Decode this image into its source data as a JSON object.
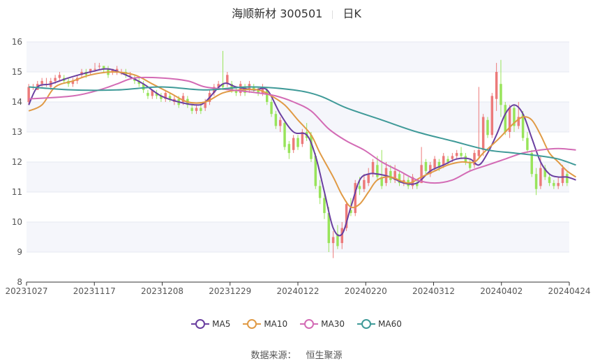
{
  "title": {
    "name": "海顺新材 300501",
    "period": "日K"
  },
  "source": {
    "label": "数据来源：",
    "value": "恒生聚源"
  },
  "colors": {
    "up": "#ec7a7a",
    "down": "#98e45a",
    "ma5": "#6a3fa0",
    "ma10": "#e09a45",
    "ma30": "#d36bb5",
    "ma60": "#3f9a98",
    "grid": "#e5e8f0",
    "band": "#f5f6fb"
  },
  "chart_data": {
    "type": "candlestick",
    "ylim": [
      8,
      16
    ],
    "yticks": [
      8,
      9,
      10,
      11,
      12,
      13,
      14,
      15,
      16
    ],
    "xticks": [
      "20231027",
      "20231117",
      "20231208",
      "20231229",
      "20240122",
      "20240220",
      "20240312",
      "20240402",
      "20240424"
    ],
    "candles": [
      [
        14.0,
        14.5,
        14.6,
        13.9
      ],
      [
        14.5,
        14.5,
        14.6,
        14.4
      ],
      [
        14.4,
        14.6,
        14.7,
        14.4
      ],
      [
        14.6,
        14.7,
        14.8,
        14.5
      ],
      [
        14.6,
        14.6,
        14.8,
        14.5
      ],
      [
        14.5,
        14.7,
        14.8,
        14.4
      ],
      [
        14.7,
        14.8,
        14.9,
        14.6
      ],
      [
        14.8,
        14.9,
        15.0,
        14.7
      ],
      [
        14.8,
        14.7,
        14.9,
        14.6
      ],
      [
        14.7,
        14.6,
        14.8,
        14.5
      ],
      [
        14.6,
        14.7,
        14.8,
        14.5
      ],
      [
        14.7,
        14.8,
        14.9,
        14.6
      ],
      [
        14.9,
        15.0,
        15.1,
        14.8
      ],
      [
        15.0,
        14.9,
        15.1,
        14.8
      ],
      [
        15.0,
        15.1,
        15.1,
        14.9
      ],
      [
        15.1,
        15.1,
        15.3,
        15.0
      ],
      [
        15.2,
        15.2,
        15.3,
        15.1
      ],
      [
        15.2,
        15.1,
        15.2,
        15.0
      ],
      [
        15.1,
        14.9,
        15.2,
        14.8
      ],
      [
        15.0,
        15.1,
        15.1,
        14.9
      ],
      [
        15.0,
        15.1,
        15.2,
        14.9
      ],
      [
        15.0,
        15.0,
        15.1,
        14.9
      ],
      [
        15.0,
        14.9,
        15.1,
        14.8
      ],
      [
        14.9,
        14.9,
        15.0,
        14.8
      ],
      [
        14.8,
        14.7,
        14.9,
        14.6
      ],
      [
        14.7,
        14.6,
        14.8,
        14.5
      ],
      [
        14.6,
        14.4,
        14.7,
        14.3
      ],
      [
        14.3,
        14.2,
        14.4,
        14.1
      ],
      [
        14.2,
        14.4,
        14.4,
        14.1
      ],
      [
        14.3,
        14.2,
        14.4,
        14.1
      ],
      [
        14.2,
        14.1,
        14.3,
        14.0
      ],
      [
        14.1,
        14.3,
        14.4,
        14.0
      ],
      [
        14.2,
        14.1,
        14.3,
        14.0
      ],
      [
        14.0,
        14.1,
        14.2,
        13.9
      ],
      [
        14.1,
        13.9,
        14.2,
        13.8
      ],
      [
        14.0,
        14.2,
        14.3,
        13.9
      ],
      [
        14.1,
        13.9,
        14.2,
        13.8
      ],
      [
        13.8,
        13.7,
        13.9,
        13.6
      ],
      [
        13.7,
        13.8,
        13.9,
        13.6
      ],
      [
        13.8,
        13.7,
        14.0,
        13.6
      ],
      [
        13.8,
        14.0,
        14.1,
        13.7
      ],
      [
        14.0,
        14.3,
        14.4,
        13.9
      ],
      [
        14.3,
        14.5,
        14.6,
        14.2
      ],
      [
        14.5,
        14.6,
        14.7,
        14.4
      ],
      [
        14.6,
        14.5,
        15.7,
        14.4
      ],
      [
        14.6,
        14.9,
        15.0,
        14.5
      ],
      [
        14.6,
        14.4,
        14.7,
        14.3
      ],
      [
        14.4,
        14.3,
        14.5,
        14.2
      ],
      [
        14.3,
        14.6,
        14.7,
        14.2
      ],
      [
        14.5,
        14.3,
        14.6,
        14.2
      ],
      [
        14.4,
        14.6,
        14.7,
        14.3
      ],
      [
        14.5,
        14.4,
        14.6,
        14.3
      ],
      [
        14.4,
        14.3,
        14.5,
        14.2
      ],
      [
        14.3,
        14.5,
        14.6,
        14.2
      ],
      [
        14.4,
        14.0,
        14.5,
        13.9
      ],
      [
        14.0,
        13.6,
        14.1,
        13.5
      ],
      [
        13.6,
        13.2,
        13.7,
        13.1
      ],
      [
        13.2,
        13.4,
        13.5,
        13.0
      ],
      [
        13.3,
        12.5,
        13.4,
        12.4
      ],
      [
        12.6,
        12.3,
        12.7,
        12.1
      ],
      [
        12.4,
        12.8,
        12.9,
        12.3
      ],
      [
        12.8,
        12.5,
        12.9,
        12.4
      ],
      [
        12.6,
        13.0,
        13.1,
        12.5
      ],
      [
        13.0,
        12.8,
        13.3,
        12.7
      ],
      [
        12.9,
        12.1,
        13.0,
        12.0
      ],
      [
        12.2,
        11.2,
        12.3,
        11.1
      ],
      [
        11.2,
        10.8,
        11.4,
        10.6
      ],
      [
        10.8,
        10.3,
        11.0,
        10.1
      ],
      [
        10.3,
        9.3,
        10.5,
        9.0
      ],
      [
        9.3,
        9.5,
        9.7,
        8.8
      ],
      [
        9.6,
        9.2,
        9.9,
        9.1
      ],
      [
        9.3,
        9.8,
        10.0,
        9.1
      ],
      [
        9.8,
        10.6,
        10.7,
        9.7
      ],
      [
        10.4,
        10.3,
        10.8,
        10.2
      ],
      [
        10.3,
        11.3,
        11.4,
        10.2
      ],
      [
        11.2,
        11.1,
        11.5,
        10.9
      ],
      [
        11.1,
        11.4,
        11.6,
        11.0
      ],
      [
        11.3,
        11.6,
        11.8,
        11.2
      ],
      [
        11.6,
        12.0,
        12.1,
        11.5
      ],
      [
        11.9,
        11.5,
        12.2,
        11.4
      ],
      [
        11.5,
        11.2,
        12.4,
        11.1
      ],
      [
        11.3,
        11.8,
        12.0,
        11.2
      ],
      [
        11.7,
        11.4,
        11.9,
        11.3
      ],
      [
        11.4,
        11.7,
        11.9,
        11.3
      ],
      [
        11.6,
        11.3,
        11.7,
        11.2
      ],
      [
        11.3,
        11.4,
        11.6,
        11.2
      ],
      [
        11.4,
        11.2,
        11.5,
        11.1
      ],
      [
        11.2,
        11.5,
        11.6,
        11.1
      ],
      [
        11.3,
        11.2,
        11.4,
        11.1
      ],
      [
        11.3,
        11.9,
        12.5,
        11.3
      ],
      [
        12.0,
        11.7,
        12.1,
        11.6
      ],
      [
        11.6,
        11.9,
        12.0,
        11.5
      ],
      [
        11.8,
        12.1,
        12.2,
        11.7
      ],
      [
        12.0,
        11.8,
        12.1,
        11.7
      ],
      [
        11.9,
        12.2,
        12.3,
        11.8
      ],
      [
        12.1,
        12.0,
        12.2,
        11.9
      ],
      [
        12.1,
        12.2,
        12.3,
        12.0
      ],
      [
        12.2,
        12.3,
        12.4,
        12.1
      ],
      [
        12.3,
        12.2,
        12.5,
        12.1
      ],
      [
        12.2,
        12.0,
        12.3,
        11.9
      ],
      [
        12.0,
        11.8,
        12.1,
        11.7
      ],
      [
        11.9,
        12.3,
        12.4,
        11.8
      ],
      [
        12.2,
        12.4,
        14.5,
        12.1
      ],
      [
        12.4,
        13.5,
        13.6,
        12.2
      ],
      [
        13.4,
        12.9,
        13.5,
        12.8
      ],
      [
        12.9,
        14.2,
        14.3,
        12.8
      ],
      [
        14.1,
        15.0,
        15.3,
        13.7
      ],
      [
        14.6,
        13.9,
        15.4,
        13.5
      ],
      [
        13.9,
        13.0,
        14.0,
        12.9
      ],
      [
        13.0,
        13.8,
        13.9,
        12.8
      ],
      [
        13.8,
        13.2,
        13.9,
        13.0
      ],
      [
        13.2,
        13.5,
        14.0,
        13.1
      ],
      [
        13.6,
        12.8,
        13.7,
        12.7
      ],
      [
        12.8,
        12.4,
        13.0,
        12.3
      ],
      [
        12.3,
        11.6,
        12.4,
        11.5
      ],
      [
        11.6,
        11.1,
        11.8,
        10.9
      ],
      [
        11.2,
        11.8,
        12.2,
        11.1
      ],
      [
        11.8,
        11.5,
        11.9,
        11.4
      ],
      [
        11.5,
        11.3,
        11.6,
        11.2
      ],
      [
        11.3,
        11.2,
        11.4,
        11.1
      ],
      [
        11.2,
        11.3,
        11.5,
        11.1
      ],
      [
        11.3,
        11.8,
        11.9,
        11.2
      ],
      [
        11.6,
        11.3,
        11.7,
        11.2
      ]
    ],
    "series": [
      {
        "name": "MA5",
        "x": [
          0,
          2,
          5,
          9,
          14,
          18,
          22,
          26,
          30,
          34,
          38,
          40,
          44,
          47,
          51,
          54,
          57,
          60,
          63,
          65,
          67,
          69,
          71,
          73,
          75,
          77,
          79,
          82,
          85,
          88,
          91,
          94,
          97,
          100,
          102,
          104,
          106,
          108,
          110,
          112,
          114,
          116,
          118,
          120,
          122,
          124
        ],
        "values": [
          13.9,
          14.5,
          14.6,
          14.8,
          15.0,
          15.1,
          14.9,
          14.6,
          14.2,
          14.0,
          13.9,
          14.0,
          14.6,
          14.5,
          14.4,
          14.4,
          13.6,
          13.0,
          12.9,
          12.2,
          11.0,
          9.8,
          9.6,
          10.5,
          11.4,
          11.6,
          11.6,
          11.5,
          11.3,
          11.3,
          11.7,
          11.9,
          12.1,
          12.1,
          11.9,
          12.3,
          12.9,
          13.6,
          13.9,
          13.6,
          12.8,
          12.0,
          11.6,
          11.5,
          11.5,
          11.4
        ]
      },
      {
        "name": "MA10",
        "x": [
          0,
          3,
          6,
          10,
          14,
          19,
          24,
          28,
          32,
          36,
          40,
          44,
          48,
          52,
          55,
          58,
          61,
          64,
          66,
          69,
          71,
          73,
          75,
          77,
          79,
          82,
          86,
          89,
          92,
          95,
          98,
          101,
          103,
          106,
          108,
          110,
          112,
          114,
          116,
          118,
          120,
          122,
          124
        ],
        "values": [
          13.7,
          13.9,
          14.5,
          14.7,
          14.9,
          15.0,
          14.9,
          14.6,
          14.3,
          14.0,
          14.0,
          14.3,
          14.4,
          14.4,
          14.2,
          13.9,
          13.4,
          12.9,
          12.3,
          11.5,
          10.9,
          10.5,
          10.6,
          11.0,
          11.4,
          11.5,
          11.3,
          11.5,
          11.7,
          11.9,
          12.0,
          12.0,
          12.3,
          12.7,
          13.0,
          13.3,
          13.5,
          13.4,
          12.9,
          12.3,
          12.0,
          11.7,
          11.5
        ]
      },
      {
        "name": "MA30",
        "x": [
          0,
          10,
          16,
          20,
          24,
          30,
          36,
          40,
          46,
          52,
          56,
          60,
          64,
          68,
          72,
          76,
          80,
          84,
          88,
          92,
          96,
          100,
          104,
          108,
          112,
          116,
          120,
          124
        ],
        "values": [
          14.1,
          14.2,
          14.4,
          14.6,
          14.8,
          14.8,
          14.7,
          14.5,
          14.4,
          14.3,
          14.2,
          14.0,
          13.7,
          13.1,
          12.7,
          12.4,
          12.0,
          11.7,
          11.4,
          11.3,
          11.4,
          11.7,
          11.9,
          12.1,
          12.3,
          12.4,
          12.45,
          12.4
        ]
      },
      {
        "name": "MA60",
        "x": [
          0,
          10,
          20,
          30,
          40,
          50,
          60,
          66,
          72,
          80,
          88,
          96,
          104,
          110,
          116,
          120,
          124
        ],
        "values": [
          14.5,
          14.4,
          14.4,
          14.5,
          14.4,
          14.5,
          14.4,
          14.2,
          13.8,
          13.4,
          13.0,
          12.7,
          12.4,
          12.3,
          12.2,
          12.1,
          11.9
        ]
      }
    ]
  }
}
